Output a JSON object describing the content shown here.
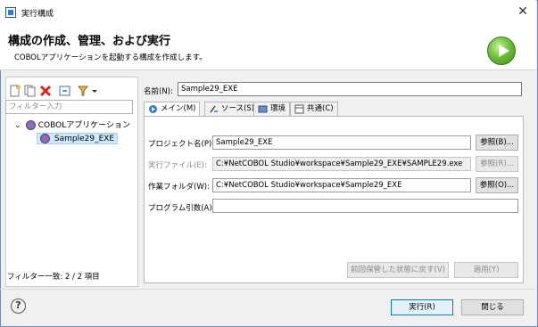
{
  "window": {
    "title": "実行構成",
    "close_glyph": "✕"
  },
  "header": {
    "title": "構成の作成、管理、および実行",
    "subtitle": "COBOLアプリケーションを起動する構成を作成します。"
  },
  "left": {
    "filter_placeholder": "フィルター入力",
    "tree": {
      "category": "COBOLアプリケーション",
      "item": "Sample29_EXE"
    },
    "filter_count": "フィルター一致: 2 / 2 項目"
  },
  "config": {
    "name_label": "名前(N):",
    "name_value": "Sample29_EXE",
    "tabs": [
      {
        "label": "メイン(M)",
        "icon": "main-tab-icon"
      },
      {
        "label": "ソース(S)",
        "icon": "source-tab-icon"
      },
      {
        "label": "環境",
        "icon": "environment-tab-icon"
      },
      {
        "label": "共通(C)",
        "icon": "common-tab-icon"
      }
    ],
    "fields": {
      "project": {
        "label": "プロジェクト名(P):",
        "value": "Sample29_EXE",
        "button": "参照(B)..."
      },
      "exe": {
        "label": "実行ファイル(E):",
        "value": "C:¥NetCOBOL Studio¥workspace¥Sample29_EXE¥SAMPLE29.exe",
        "button": "参照(R)..."
      },
      "workdir": {
        "label": "作業フォルダ(W):",
        "value": "C:¥NetCOBOL Studio¥workspace¥Sample29_EXE",
        "button": "参照(O)..."
      },
      "args": {
        "label": "プログラム引数(A):",
        "value": ""
      }
    },
    "revert_button": "前回保管した状態に戻す(V)",
    "apply_button": "適用(Y)"
  },
  "footer": {
    "help_glyph": "?",
    "run_button": "実行(R)",
    "close_button": "閉じる"
  }
}
